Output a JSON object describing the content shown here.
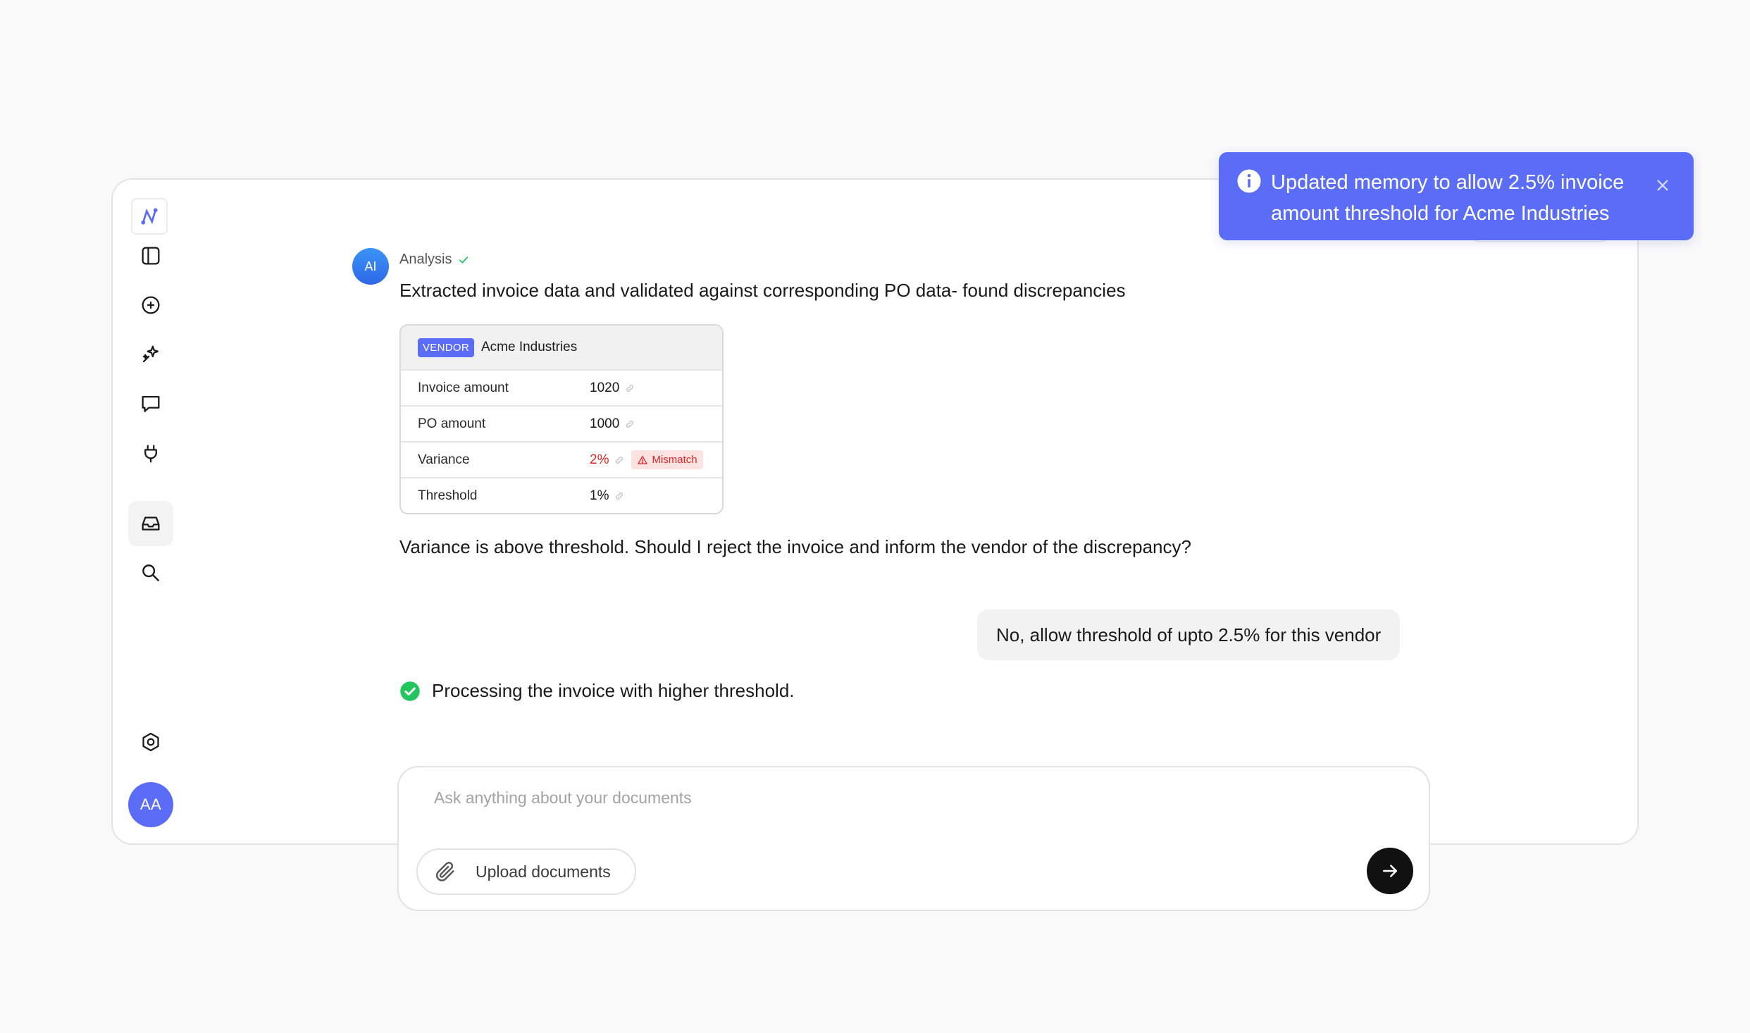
{
  "sidebar": {
    "items": [
      {
        "name": "app-logo",
        "icon": "logo-icon"
      },
      {
        "name": "toggle-sidebar",
        "icon": "sidebar-panel-icon"
      },
      {
        "name": "new-chat",
        "icon": "plus-circle-icon"
      },
      {
        "name": "ai-tools",
        "icon": "sparkle-wand-icon"
      },
      {
        "name": "chats",
        "icon": "chat-bubble-icon"
      },
      {
        "name": "integrations",
        "icon": "plug-icon"
      },
      {
        "name": "inbox",
        "icon": "inbox-tray-icon",
        "active": true
      },
      {
        "name": "search",
        "icon": "search-icon"
      },
      {
        "name": "settings",
        "icon": "gear-hex-icon"
      }
    ],
    "avatar_initials": "AA"
  },
  "conversation": {
    "ai_badge": "AI",
    "analysis_label": "Analysis",
    "ai_message_1": "Extracted invoice data and validated against corresponding PO data- found discrepancies",
    "card": {
      "vendor_tag": "VENDOR",
      "vendor_name": "Acme Industries",
      "rows": [
        {
          "label": "Invoice amount",
          "value": "1020"
        },
        {
          "label": "PO amount",
          "value": "1000"
        },
        {
          "label": "Variance",
          "value": "2%",
          "flag": "Mismatch"
        },
        {
          "label": "Threshold",
          "value": "1%"
        }
      ]
    },
    "ai_message_2": "Variance is above threshold. Should I reject the invoice and inform the vendor of the discrepancy?",
    "user_message": "No, allow threshold of upto 2.5% for this vendor",
    "status_message": "Processing the invoice with higher threshold."
  },
  "composer": {
    "placeholder": "Ask anything about your documents",
    "value": "",
    "upload_label": "Upload documents"
  },
  "toast": {
    "message": "Updated memory to allow 2.5% invoice amount threshold for Acme Industries"
  },
  "colors": {
    "accent": "#5b6cf6",
    "danger": "#dc2626",
    "success": "#22c55e"
  }
}
